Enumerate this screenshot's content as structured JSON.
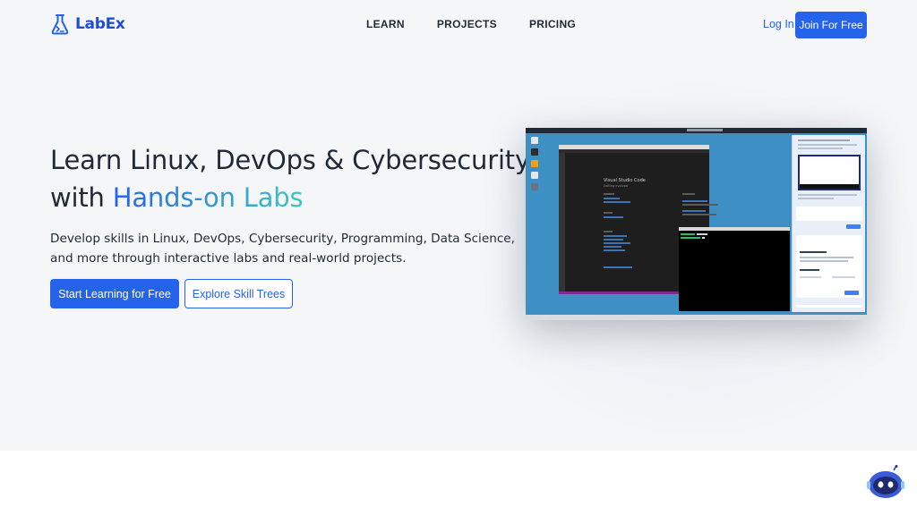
{
  "brand": {
    "name": "LabEx",
    "accent": "#2563eb",
    "gradient_end": "#3ec6c0"
  },
  "nav": {
    "items": [
      "LEARN",
      "PROJECTS",
      "PRICING"
    ]
  },
  "auth": {
    "login_label": "Log In",
    "join_label": "Join For Free"
  },
  "hero": {
    "headline_line1": "Learn Linux, DevOps & Cybersecurity",
    "headline_prefix": "with ",
    "headline_accent": "Hands-on Labs",
    "subtitle": "Develop skills in Linux, DevOps, Cybersecurity, Programming, Data Science, and more through interactive labs and real-world projects.",
    "primary_cta": "Start Learning for Free",
    "secondary_cta": "Explore Skill Trees"
  },
  "preview": {
    "editor_title": "Visual Studio Code",
    "editor_subtitle": "Editing evolved",
    "chat_heading": "Welcome to LabEx"
  },
  "icons": {
    "logo": "flask-icon",
    "chatbot": "robot-icon"
  }
}
